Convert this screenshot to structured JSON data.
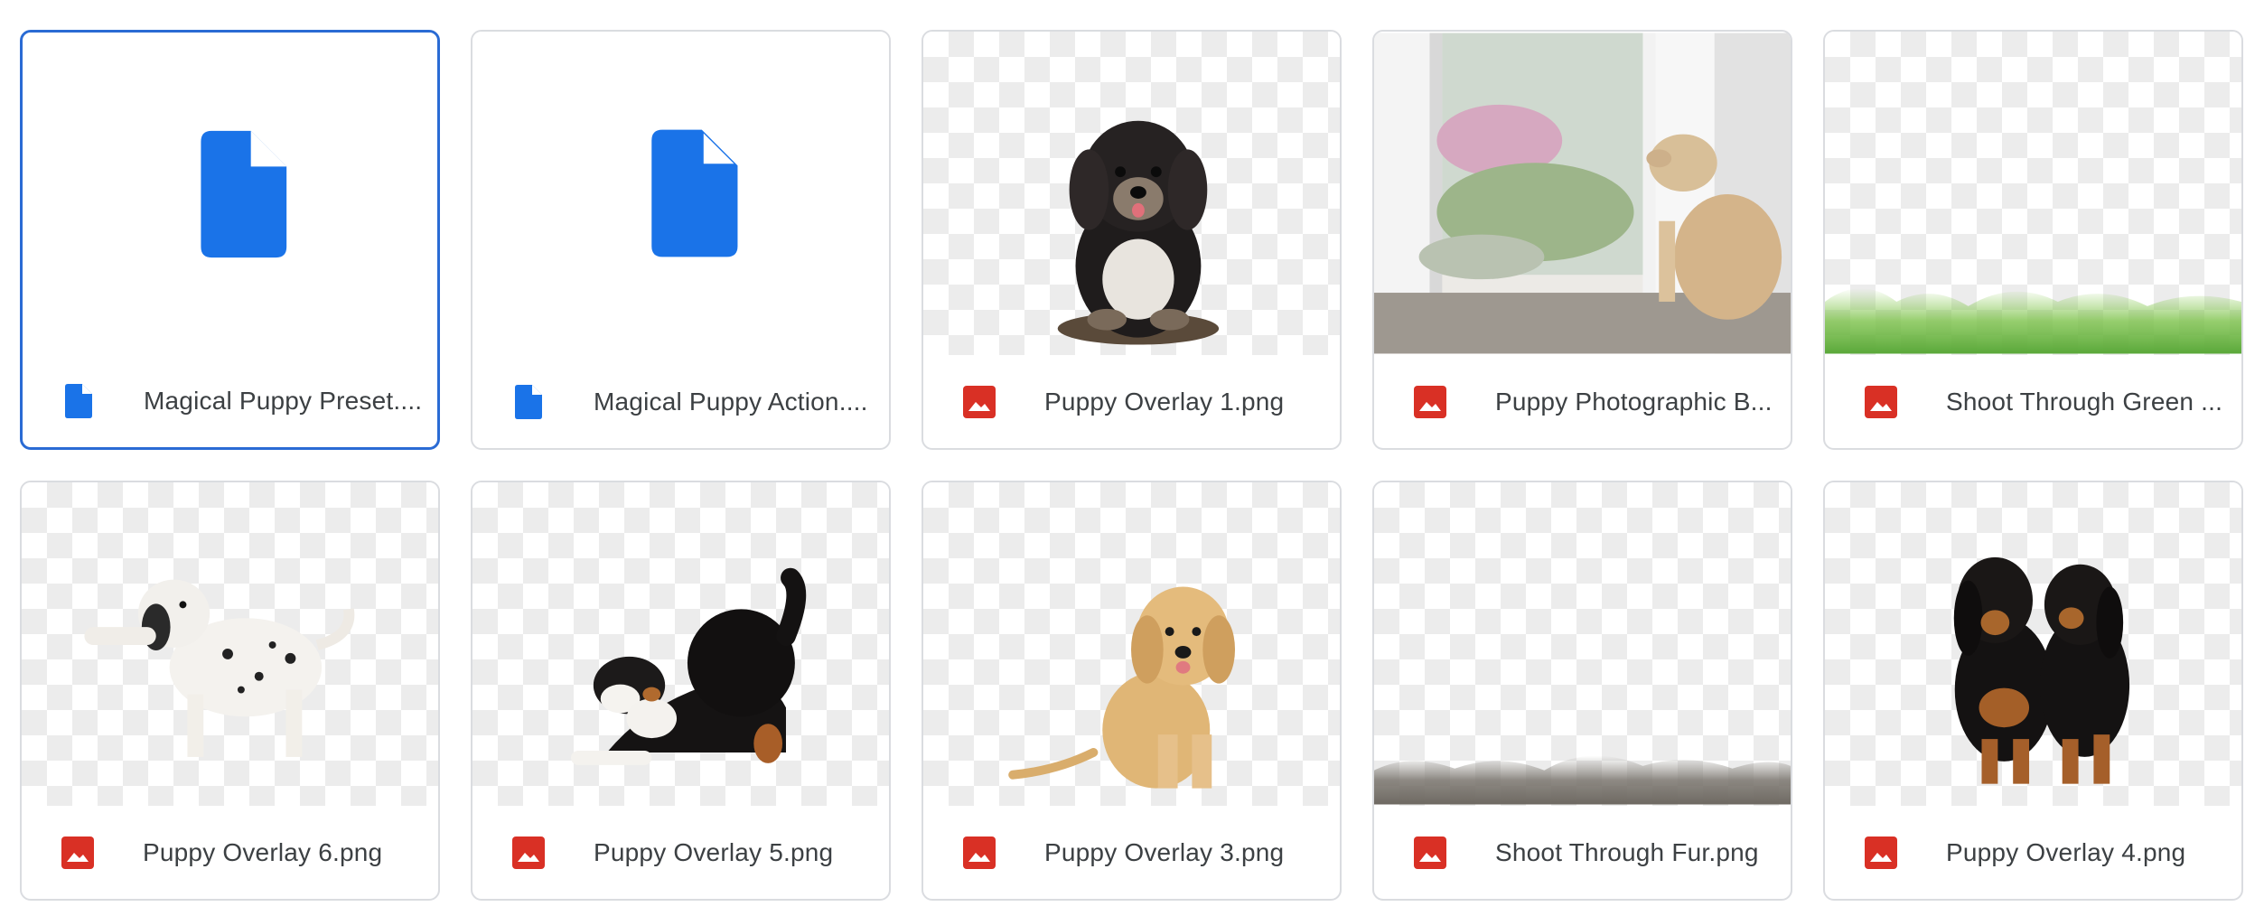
{
  "files": [
    {
      "name": "Magical Puppy Preset....",
      "type": "document",
      "icon": "document-icon",
      "preview": "document-preview",
      "selected": true
    },
    {
      "name": "Magical Puppy Action....",
      "type": "document",
      "icon": "document-icon",
      "preview": "document-preview",
      "selected": false
    },
    {
      "name": "Puppy Overlay 1.png",
      "type": "image",
      "icon": "image-icon",
      "preview": "black-fluffy-puppy-sitting",
      "selected": false
    },
    {
      "name": "Puppy Photographic B...",
      "type": "image",
      "icon": "image-icon",
      "preview": "puppy-looking-out-window",
      "selected": false
    },
    {
      "name": "Shoot Through Green ...",
      "type": "image",
      "icon": "image-icon",
      "preview": "green-grass-strip",
      "selected": false
    },
    {
      "name": "Puppy Overlay 6.png",
      "type": "image",
      "icon": "image-icon",
      "preview": "dalmatian-puppy",
      "selected": false
    },
    {
      "name": "Puppy Overlay 5.png",
      "type": "image",
      "icon": "image-icon",
      "preview": "bernese-puppy-stretching",
      "selected": false
    },
    {
      "name": "Puppy Overlay 3.png",
      "type": "image",
      "icon": "image-icon",
      "preview": "golden-retriever-puppy-sitting",
      "selected": false
    },
    {
      "name": "Shoot Through Fur.png",
      "type": "image",
      "icon": "image-icon",
      "preview": "fur-strip",
      "selected": false
    },
    {
      "name": "Puppy Overlay 4.png",
      "type": "image",
      "icon": "image-icon",
      "preview": "two-hound-puppies",
      "selected": false
    }
  ],
  "colors": {
    "document_blue": "#1a73e8",
    "image_red": "#d93025",
    "selection_border": "#2a6bd4",
    "card_border": "#dadce0",
    "text": "#3c4043"
  }
}
